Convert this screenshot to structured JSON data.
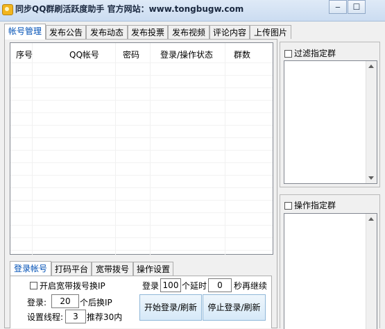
{
  "window": {
    "title": "同步QQ群刷活跃度助手   官方网站：www.tongbugw.com",
    "minimize": "‒",
    "maximize": "☐"
  },
  "tabs": [
    "帐号管理",
    "发布公告",
    "发布动态",
    "发布投票",
    "发布视频",
    "评论内容",
    "上传图片"
  ],
  "accounts": {
    "columns": [
      "序号",
      "QQ帐号",
      "密码",
      "登录/操作状态",
      "群数"
    ],
    "rows": []
  },
  "subtabs": [
    "登录帐号",
    "打码平台",
    "宽带拨号",
    "操作设置"
  ],
  "login": {
    "broadband_ip_label": "开启宽带拨号换IP",
    "login_prefix": "登录:",
    "login_count": "20",
    "login_suffix": "个后换IP",
    "threads_label": "设置线程:",
    "threads_value": "3",
    "threads_hint": "推荐30内",
    "batch_prefix": "登录",
    "batch_count": "100",
    "batch_mid": "个延时",
    "delay_value": "0",
    "delay_suffix": "秒再继续",
    "start_button": "开始登录/刷新",
    "stop_button": "停止登录/刷新"
  },
  "right_panels": {
    "filter_groups": "过滤指定群",
    "operate_groups": "操作指定群"
  }
}
